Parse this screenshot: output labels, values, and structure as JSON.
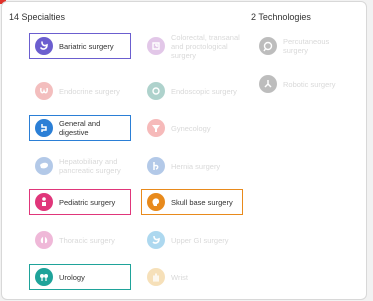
{
  "specialties_heading": "14 Specialties",
  "technologies_heading": "2 Technologies",
  "specialties": [
    {
      "label": "Bariatric surgery",
      "icon": "stomach-icon",
      "color": "#6b5ecf",
      "selected": true
    },
    {
      "label": "Colorectal, transanal and proctological surgery",
      "icon": "intestine-icon",
      "color": "#b56fc4",
      "selected": false
    },
    {
      "label": "Endocrine surgery",
      "icon": "thyroid-icon",
      "color": "#e25757",
      "selected": false
    },
    {
      "label": "Endoscopic surgery",
      "icon": "endoscope-icon",
      "color": "#2e8c7a",
      "selected": false
    },
    {
      "label": "General and digestive",
      "icon": "digestive-icon",
      "color": "#2b7fd6",
      "selected": true
    },
    {
      "label": "Gynecology",
      "icon": "uterus-icon",
      "color": "#e84b4b",
      "selected": false
    },
    {
      "label": "Hepatobiliary and pancreatic surgery",
      "icon": "liver-icon",
      "color": "#3a74c4",
      "selected": false
    },
    {
      "label": "Hernia surgery",
      "icon": "hernia-icon",
      "color": "#3a74c4",
      "selected": false
    },
    {
      "label": "Pediatric surgery",
      "icon": "child-icon",
      "color": "#e0367a",
      "selected": true
    },
    {
      "label": "Skull base surgery",
      "icon": "skull-icon",
      "color": "#e88a1c",
      "selected": true
    },
    {
      "label": "Thoracic surgery",
      "icon": "lungs-icon",
      "color": "#d6489b",
      "selected": false
    },
    {
      "label": "Upper GI surgery",
      "icon": "stomach-upper-icon",
      "color": "#2b9bd6",
      "selected": false
    },
    {
      "label": "Urology",
      "icon": "kidney-icon",
      "color": "#1fa39a",
      "selected": true
    },
    {
      "label": "Wrist",
      "icon": "hand-icon",
      "color": "#e8b04a",
      "selected": false
    }
  ],
  "technologies": [
    {
      "label": "Percutaneous surgery",
      "icon": "needle-icon",
      "color": "#555555",
      "selected": false
    },
    {
      "label": "Robotic surgery",
      "icon": "robot-icon",
      "color": "#555555",
      "selected": false
    }
  ]
}
